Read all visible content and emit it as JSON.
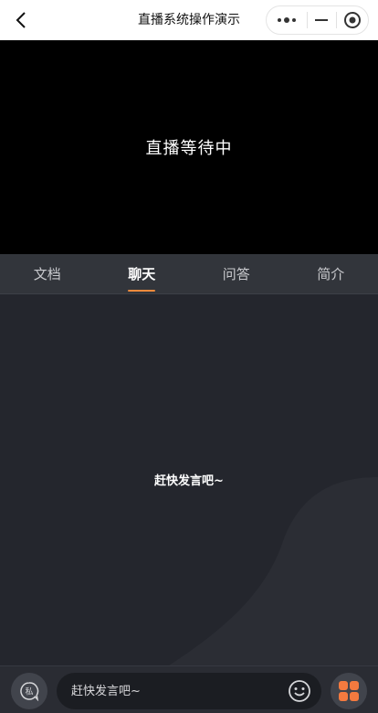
{
  "navbar": {
    "title": "直播系统操作演示",
    "back_icon": "chevron-left-icon",
    "capsule": {
      "more_icon": "more-dots-icon",
      "minimize_icon": "minimize-icon",
      "close_icon": "target-close-icon"
    }
  },
  "video": {
    "status": "直播等待中"
  },
  "tabs": [
    {
      "label": "文档",
      "active": false
    },
    {
      "label": "聊天",
      "active": true
    },
    {
      "label": "问答",
      "active": false
    },
    {
      "label": "简介",
      "active": false
    }
  ],
  "chat": {
    "empty_text": "赶快发言吧~"
  },
  "bottom_bar": {
    "private_label": "私",
    "input_placeholder": "赶快发言吧~",
    "emoji_icon": "emoji-icon",
    "more_icon": "apps-grid-icon"
  },
  "colors": {
    "accent": "#f08a3c",
    "chat_bg": "#24262d",
    "tab_bg": "#32353b",
    "grid_orange": "#f47a3f"
  }
}
